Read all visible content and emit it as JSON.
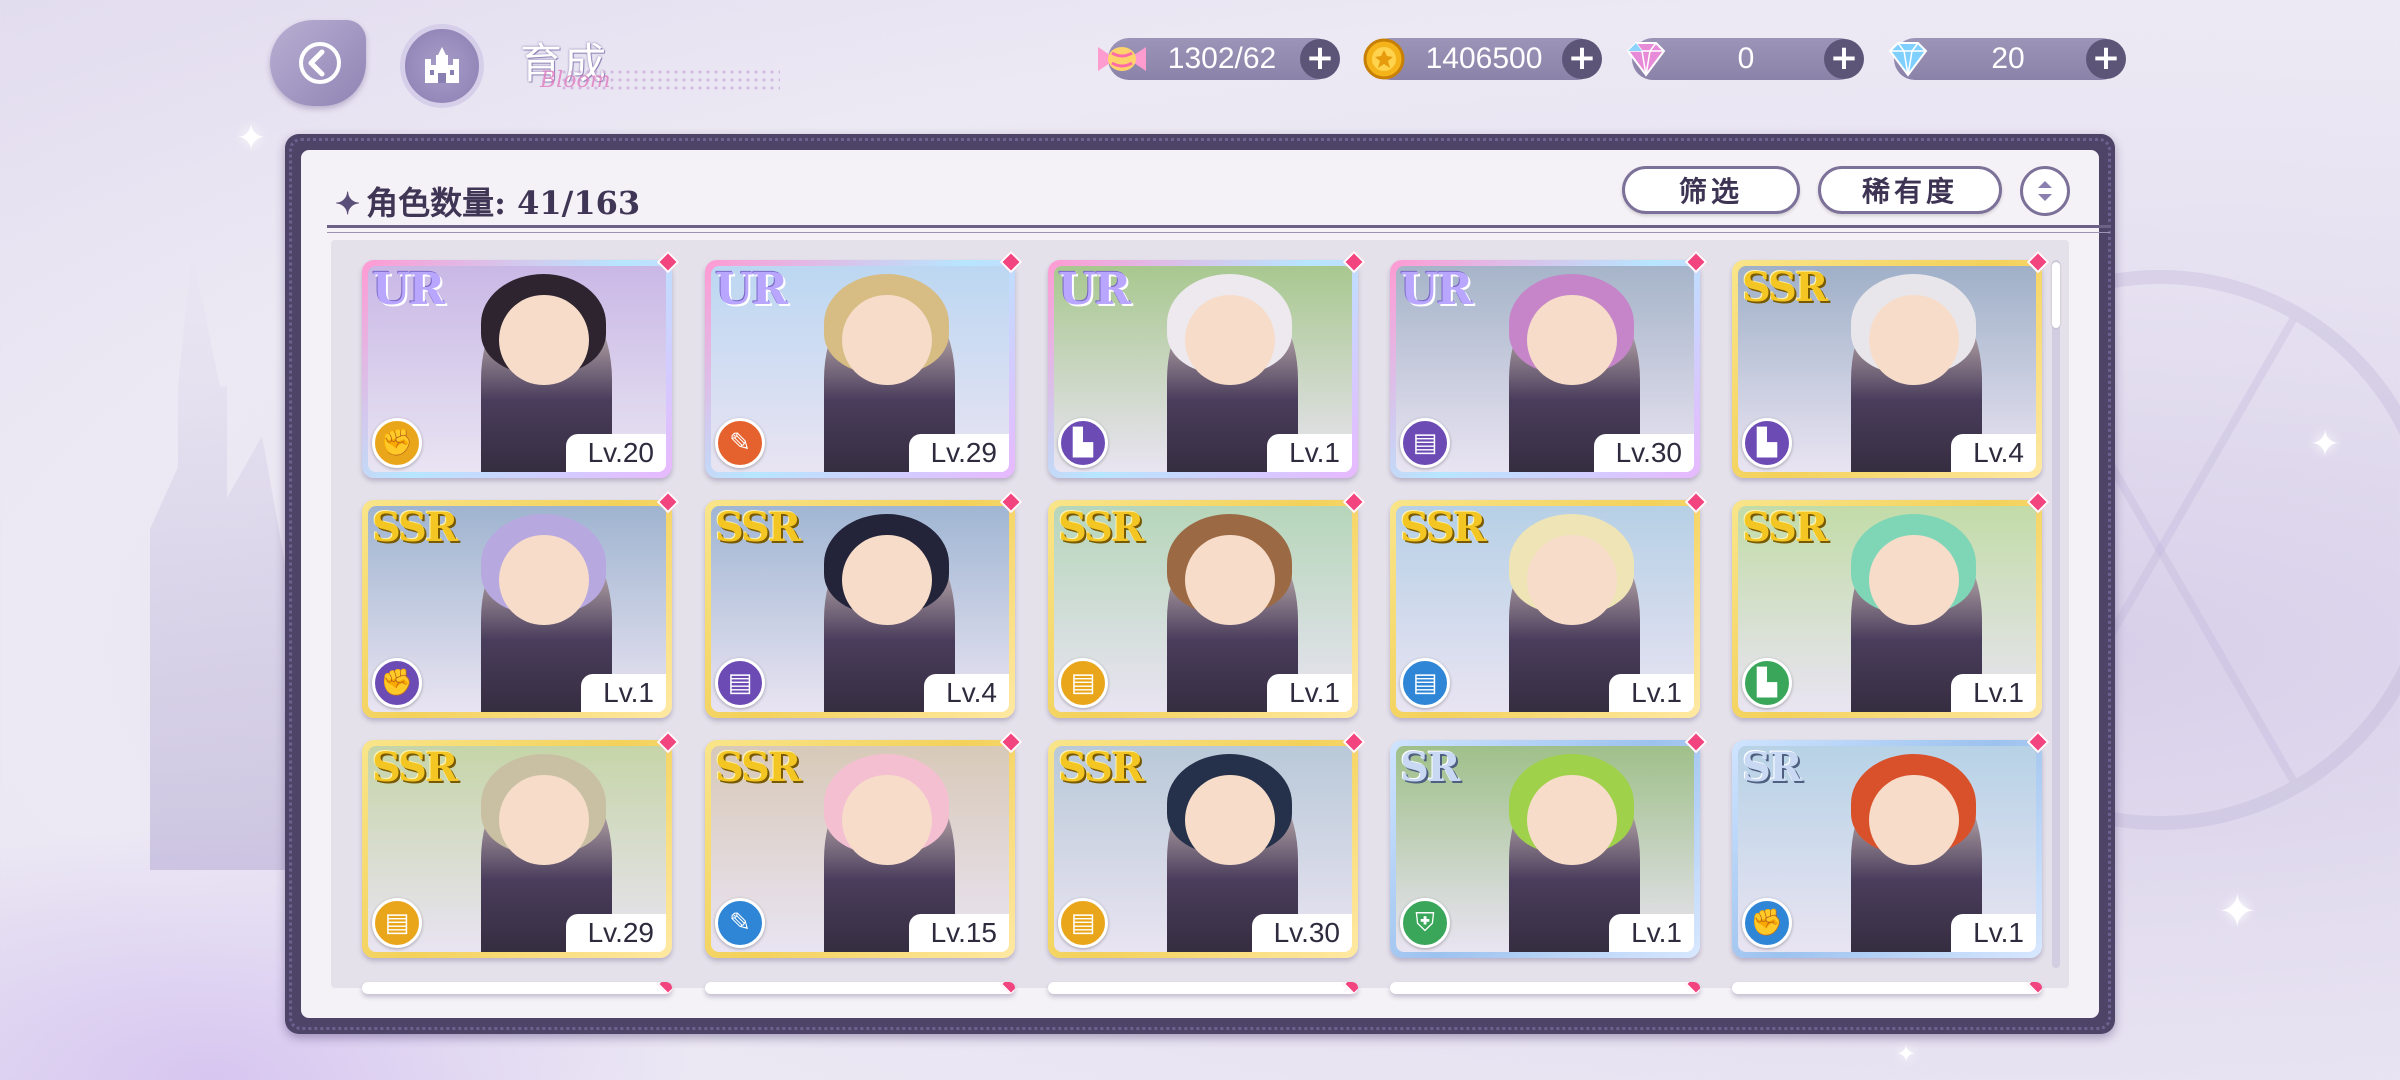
{
  "header": {
    "title": "育成",
    "title_script": "Bloom",
    "back_label": "back",
    "home_label": "home"
  },
  "currencies": [
    {
      "name": "candy",
      "value": "1302/62",
      "icon": "candy-icon"
    },
    {
      "name": "gold",
      "value": "1406500",
      "icon": "coin-icon"
    },
    {
      "name": "pink_gem",
      "value": "0",
      "icon": "pink-gem-icon"
    },
    {
      "name": "blue_gem",
      "value": "20",
      "icon": "blue-gem-icon"
    }
  ],
  "panel": {
    "count_label": "角色数量: 41/163",
    "filter_label": "筛选",
    "sort_label": "稀有度"
  },
  "colors": {
    "frame": "#4e4468",
    "accent_pink": "#f2447f",
    "attr_yellow": "#e9a61a",
    "attr_red": "#e5622f",
    "attr_purple": "#6c4bb4",
    "attr_blue": "#2f86d6",
    "attr_green": "#3aa65a"
  },
  "cards": [
    {
      "rarity": "UR",
      "level": "Lv.20",
      "attr": "yellow",
      "attr_icon": "fist-icon",
      "hair": "#2d2430",
      "bg": "#c9b8e6"
    },
    {
      "rarity": "UR",
      "level": "Lv.29",
      "attr": "red",
      "attr_icon": "wrench-icon",
      "hair": "#d7bd83",
      "bg": "#bcd7f2"
    },
    {
      "rarity": "UR",
      "level": "Lv.1",
      "attr": "purple",
      "attr_icon": "boot-icon",
      "hair": "#ede9ef",
      "bg": "#a8c88f"
    },
    {
      "rarity": "UR",
      "level": "Lv.30",
      "attr": "purple",
      "attr_icon": "book-icon",
      "hair": "#c585c8",
      "bg": "#a6b4c9"
    },
    {
      "rarity": "SSR",
      "level": "Lv.4",
      "attr": "purple",
      "attr_icon": "boot-icon",
      "hair": "#e8e6ea",
      "bg": "#9fb0c8"
    },
    {
      "rarity": "SSR",
      "level": "Lv.1",
      "attr": "purple",
      "attr_icon": "fist-icon",
      "hair": "#b7a8e0",
      "bg": "#9fb4d0"
    },
    {
      "rarity": "SSR",
      "level": "Lv.4",
      "attr": "purple",
      "attr_icon": "book-icon",
      "hair": "#23233a",
      "bg": "#a0b6d3"
    },
    {
      "rarity": "SSR",
      "level": "Lv.1",
      "attr": "yellow",
      "attr_icon": "book-icon",
      "hair": "#9b6a45",
      "bg": "#b6d6ba"
    },
    {
      "rarity": "SSR",
      "level": "Lv.1",
      "attr": "blue",
      "attr_icon": "book-icon",
      "hair": "#efe4b6",
      "bg": "#b6d0e6"
    },
    {
      "rarity": "SSR",
      "level": "Lv.1",
      "attr": "green",
      "attr_icon": "boot-icon",
      "hair": "#7fd6b7",
      "bg": "#c2dca8"
    },
    {
      "rarity": "SSR",
      "level": "Lv.29",
      "attr": "yellow",
      "attr_icon": "book-icon",
      "hair": "#c9c0a4",
      "bg": "#c6d5a8"
    },
    {
      "rarity": "SSR",
      "level": "Lv.15",
      "attr": "blue",
      "attr_icon": "wrench-icon",
      "hair": "#f5bfd2",
      "bg": "#d8c9b8"
    },
    {
      "rarity": "SSR",
      "level": "Lv.30",
      "attr": "yellow",
      "attr_icon": "book-icon",
      "hair": "#25304a",
      "bg": "#b9c9d8"
    },
    {
      "rarity": "SR",
      "level": "Lv.1",
      "attr": "green",
      "attr_icon": "shield-icon",
      "hair": "#9fd14a",
      "bg": "#9fc08a"
    },
    {
      "rarity": "SR",
      "level": "Lv.1",
      "attr": "blue",
      "attr_icon": "fist-icon",
      "hair": "#d9512b",
      "bg": "#b7d2e6"
    }
  ]
}
